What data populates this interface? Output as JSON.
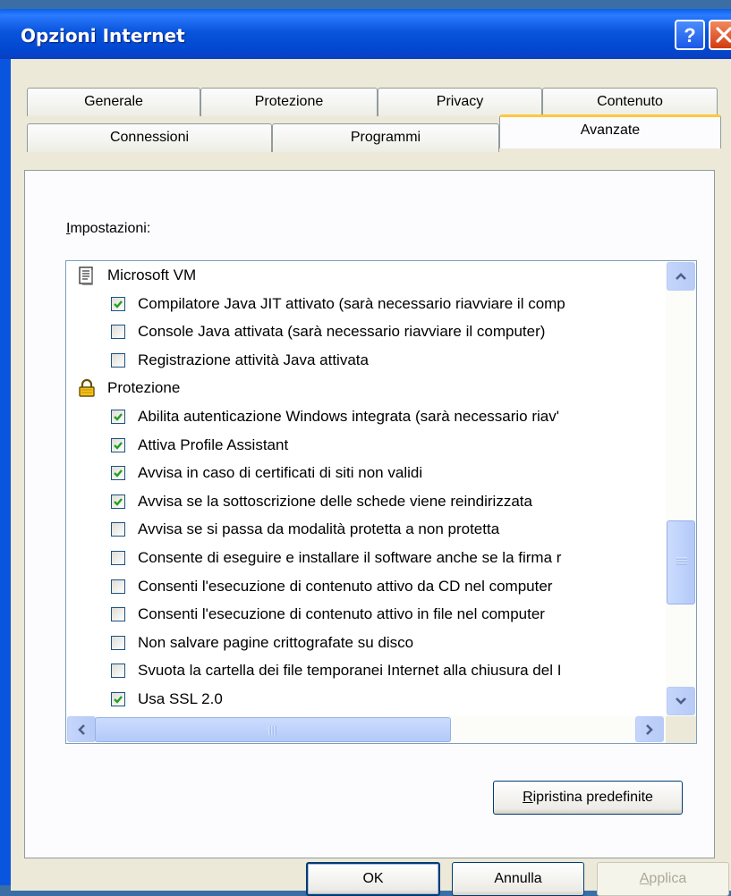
{
  "window": {
    "title": "Opzioni Internet"
  },
  "tabs_row_back": [
    {
      "label": "Generale"
    },
    {
      "label": "Protezione"
    },
    {
      "label": "Privacy"
    },
    {
      "label": "Contenuto"
    }
  ],
  "tabs_row_front": [
    {
      "label": "Connessioni"
    },
    {
      "label": "Programmi"
    },
    {
      "label": "Avanzate",
      "active": true
    }
  ],
  "settings": {
    "label": "Impostazioni:",
    "label_access_key": "I",
    "label_rest": "mpostazioni:",
    "rows": [
      {
        "type": "group",
        "icon": "document-icon",
        "label": "Microsoft VM"
      },
      {
        "type": "item",
        "checked": true,
        "label": "Compilatore Java JIT attivato (sarà necessario riavviare il comp"
      },
      {
        "type": "item",
        "checked": false,
        "label": "Console Java attivata (sarà necessario riavviare il computer)"
      },
      {
        "type": "item",
        "checked": false,
        "label": "Registrazione attività Java attivata"
      },
      {
        "type": "group",
        "icon": "lock-icon",
        "label": "Protezione"
      },
      {
        "type": "item",
        "checked": true,
        "label": "Abilita autenticazione Windows integrata (sarà necessario riav'"
      },
      {
        "type": "item",
        "checked": true,
        "label": "Attiva Profile Assistant"
      },
      {
        "type": "item",
        "checked": true,
        "label": "Avvisa in caso di certificati di siti non validi"
      },
      {
        "type": "item",
        "checked": true,
        "label": "Avvisa se la sottoscrizione delle schede viene reindirizzata"
      },
      {
        "type": "item",
        "checked": false,
        "label": "Avvisa se si passa da modalità protetta a non protetta"
      },
      {
        "type": "item",
        "checked": false,
        "label": "Consente di eseguire e installare il software anche se la firma r"
      },
      {
        "type": "item",
        "checked": false,
        "label": "Consenti l'esecuzione di contenuto attivo da CD nel computer"
      },
      {
        "type": "item",
        "checked": false,
        "label": "Consenti l'esecuzione di contenuto attivo in file nel computer"
      },
      {
        "type": "item",
        "checked": false,
        "label": "Non salvare pagine crittografate su disco"
      },
      {
        "type": "item",
        "checked": false,
        "label": "Svuota la cartella dei file temporanei Internet alla chiusura del I"
      },
      {
        "type": "item",
        "checked": true,
        "label": "Usa SSL 2.0"
      }
    ]
  },
  "buttons": {
    "restore": {
      "label": "Ripristina predefinite",
      "access_key": "R",
      "rest": "ipristina predefinite"
    },
    "ok": {
      "label": "OK"
    },
    "cancel": {
      "label": "Annulla"
    },
    "apply": {
      "label": "Applica",
      "access_key": "A",
      "rest": "pplica",
      "disabled": true
    }
  },
  "colors": {
    "title_bar": "#0a55dc",
    "dialog_face": "#ece9d8",
    "active_tab_accent": "#ffc83c",
    "checkmark": "#21a121"
  }
}
